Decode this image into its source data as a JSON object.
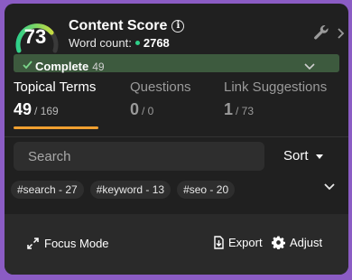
{
  "header": {
    "score": "73",
    "score_fraction": 0.73,
    "title": "Content Score",
    "word_count_label": "Word count:",
    "word_count_value": "2768"
  },
  "tabs": [
    {
      "label": "Topical Terms",
      "count": "49",
      "total": "/ 169",
      "active": true
    },
    {
      "label": "Questions",
      "count": "0",
      "total": "/ 0",
      "active": false
    },
    {
      "label": "Link Suggestions",
      "count": "1",
      "total": "/ 73",
      "active": false
    }
  ],
  "search": {
    "placeholder": "Search"
  },
  "sort": {
    "label": "Sort"
  },
  "chips": [
    "#search - 27",
    "#keyword - 13",
    "#seo - 20"
  ],
  "actions": {
    "focus_mode": "Focus Mode",
    "export": "Export",
    "adjust": "Adjust"
  },
  "group": {
    "label": "Complete",
    "count": "49"
  },
  "colors": {
    "frame": "#8b5cc4",
    "panel": "#202020",
    "gauge_green": "#2fd08a",
    "gauge_yellow": "#d6dc3a",
    "tab_accent": "#f0a030",
    "complete_bg": "#3d5a3e"
  },
  "icons": {
    "info": "info-icon",
    "settings": "wrench-icon",
    "expand": "chevron-right-icon",
    "sort": "caret-down-icon",
    "more_chips": "chevron-down-icon",
    "focus": "expand-arrows-icon",
    "export": "export-icon",
    "adjust": "gear-icon",
    "complete": "check-icon"
  }
}
